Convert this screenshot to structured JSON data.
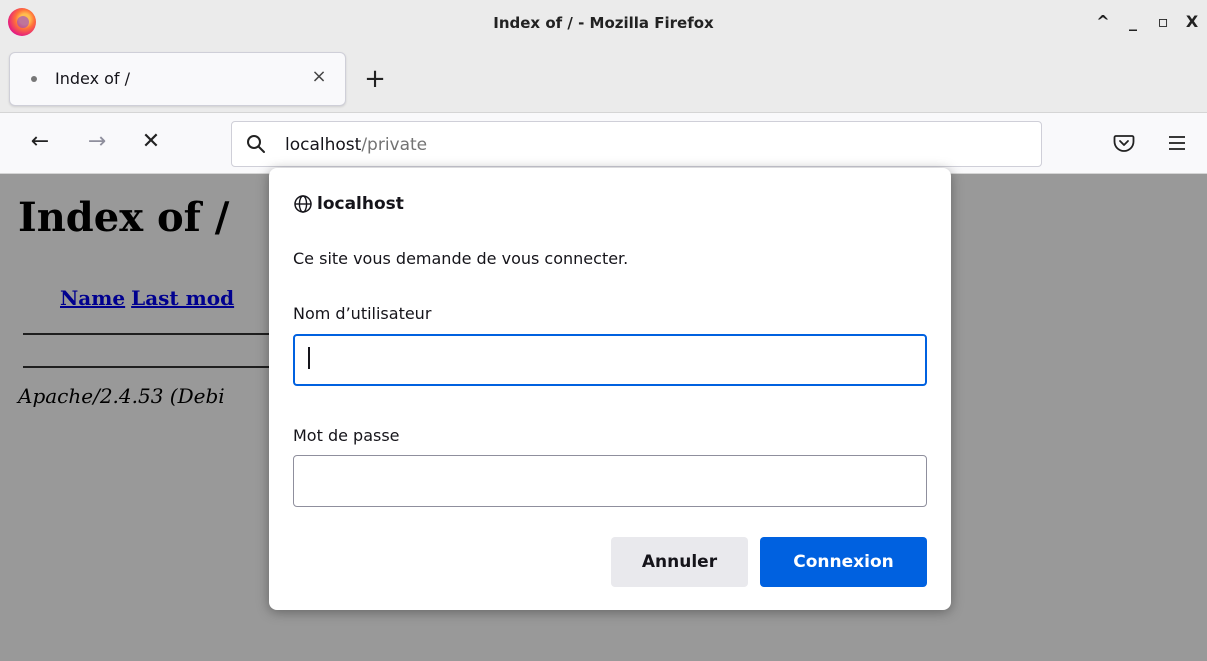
{
  "window": {
    "title": "Index of / - Mozilla Firefox",
    "controls": {
      "minimize_up": "^",
      "minimize": "_",
      "maximize": "▫",
      "close": "X"
    }
  },
  "tabs": [
    {
      "title": "Index of /",
      "close": "×"
    }
  ],
  "new_tab": "+",
  "nav": {
    "back": "←",
    "forward": "→",
    "stop": "✕",
    "url_host": "localhost",
    "url_path": "/private"
  },
  "page": {
    "heading": "Index of /",
    "columns": [
      "Name",
      "Last mod"
    ],
    "footer": "Apache/2.4.53 (Debi"
  },
  "dialog": {
    "host": "localhost",
    "message": "Ce site vous demande de vous connecter.",
    "username_label": "Nom d’utilisateur",
    "username_value": "",
    "password_label": "Mot de passe",
    "password_value": "",
    "cancel_label": "Annuler",
    "ok_label": "Connexion"
  },
  "colors": {
    "accent": "#0061e0",
    "link": "#0000ee"
  },
  "icons": {
    "browser_logo": "firefox-logo",
    "url_search": "search-icon",
    "pocket": "pocket-icon",
    "menu": "hamburger-menu-icon",
    "dialog_site": "globe-icon"
  }
}
